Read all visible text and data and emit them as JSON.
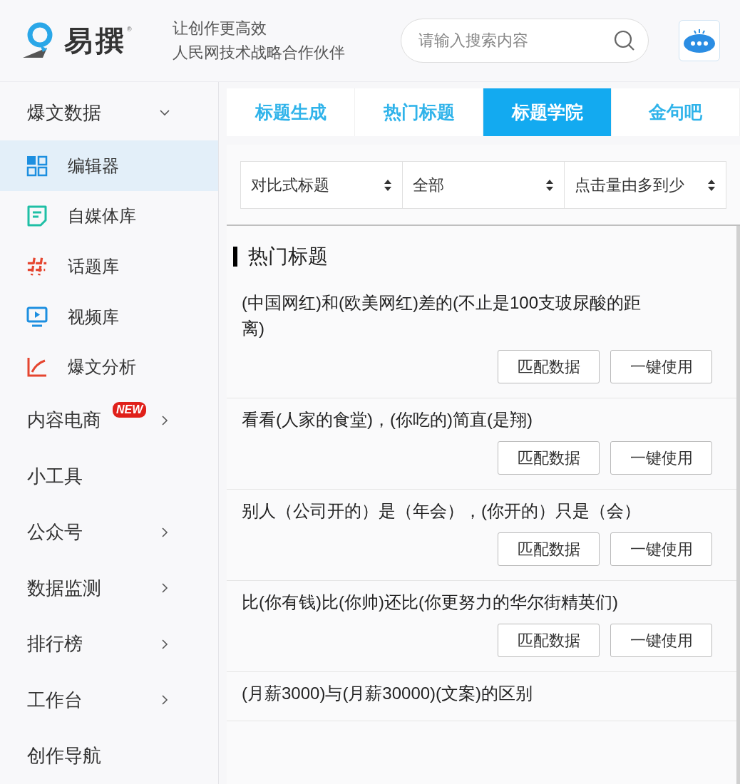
{
  "header": {
    "logo_text": "易撰",
    "logo_mark": "®",
    "slogan_lines": [
      "让创作更高效",
      "人民网技术战略合作伙伴"
    ],
    "search": {
      "placeholder": "请输入搜索内容"
    }
  },
  "sidebar": {
    "items": [
      {
        "kind": "group",
        "label": "爆文数据",
        "expanded": true,
        "selected": false
      },
      {
        "kind": "sub",
        "label": "编辑器",
        "selected": true
      },
      {
        "kind": "sub",
        "label": "自媒体库",
        "selected": false
      },
      {
        "kind": "sub",
        "label": "话题库",
        "selected": false
      },
      {
        "kind": "sub",
        "label": "视频库",
        "selected": false
      },
      {
        "kind": "sub",
        "label": "爆文分析",
        "selected": false
      },
      {
        "kind": "group",
        "label": "内容电商",
        "badge": "NEW",
        "expanded": false,
        "selected": false
      },
      {
        "kind": "link",
        "label": "小工具",
        "selected": false
      },
      {
        "kind": "group",
        "label": "公众号",
        "expanded": false,
        "selected": false
      },
      {
        "kind": "group",
        "label": "数据监测",
        "expanded": false,
        "selected": false
      },
      {
        "kind": "group",
        "label": "排行榜",
        "expanded": false,
        "selected": false
      },
      {
        "kind": "group",
        "label": "工作台",
        "expanded": false,
        "selected": false
      },
      {
        "kind": "link",
        "label": "创作导航",
        "selected": false
      }
    ]
  },
  "tabs": [
    {
      "label": "标题生成",
      "selected": false
    },
    {
      "label": "热门标题",
      "selected": false
    },
    {
      "label": "标题学院",
      "selected": true
    },
    {
      "label": "金句吧",
      "selected": false
    }
  ],
  "filters": [
    {
      "value": "对比式标题"
    },
    {
      "value": "全部"
    },
    {
      "value": "点击量由多到少"
    }
  ],
  "section": {
    "title": "热门标题",
    "items": [
      {
        "text": "(中国网红)和(欧美网红)差的(不止是100支玻尿酸的距离)",
        "buttons": [
          "匹配数据",
          "一键使用"
        ]
      },
      {
        "text": "看看(人家的食堂)，(你吃的)简直(是翔)",
        "buttons": [
          "匹配数据",
          "一键使用"
        ]
      },
      {
        "text": "别人（公司开的）是（年会），(你开的）只是（会）",
        "buttons": [
          "匹配数据",
          "一键使用"
        ]
      },
      {
        "text": "比(你有钱)比(你帅)还比(你更努力的华尔街精英们)",
        "buttons": [
          "匹配数据",
          "一键使用"
        ]
      },
      {
        "text": "(月薪3000)与(月薪30000)(文案)的区别"
      }
    ]
  }
}
